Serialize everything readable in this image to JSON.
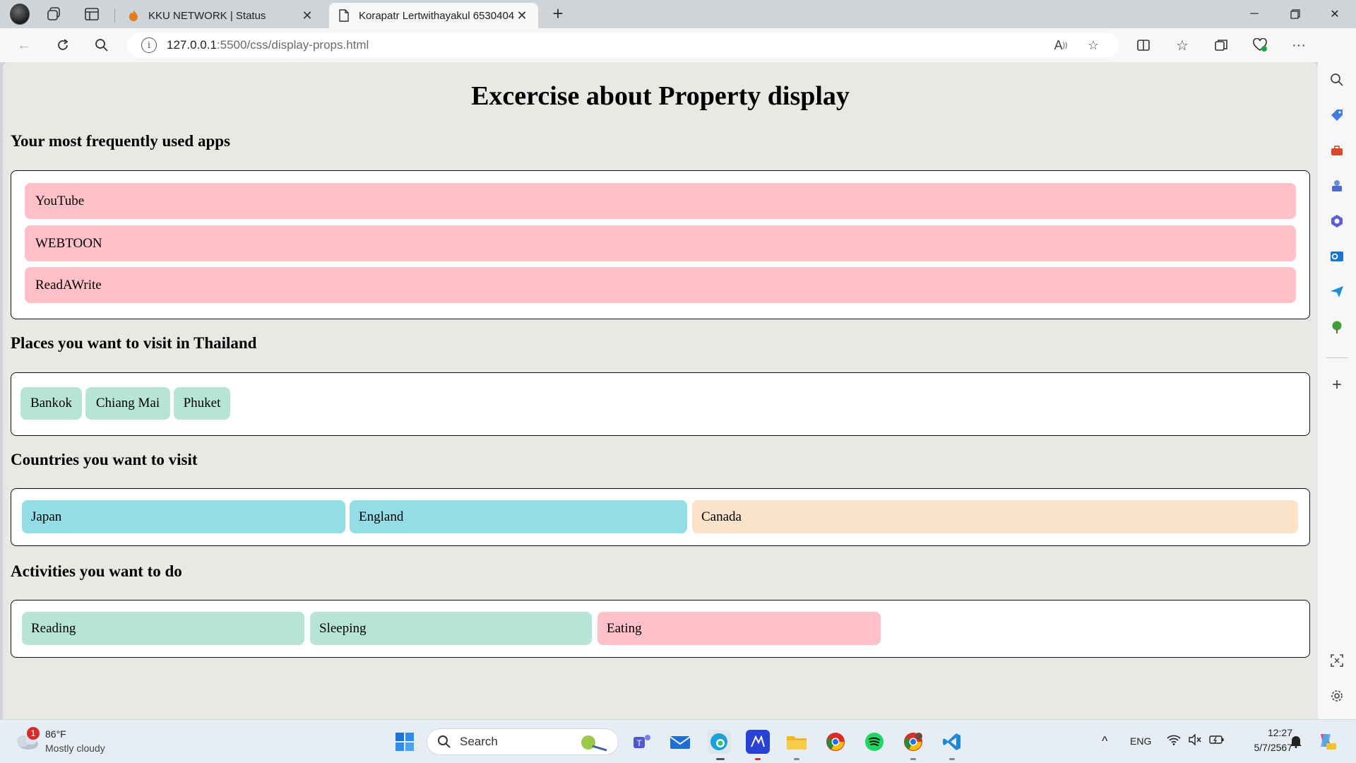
{
  "browser": {
    "tabs": [
      {
        "title": "KKU NETWORK | Status",
        "active": false
      },
      {
        "title": "Korapatr Lertwithayakul 6530404",
        "active": true
      }
    ],
    "url_host": "127.0.0.1",
    "url_path": ":5500/css/display-props.html"
  },
  "page": {
    "title": "Excercise about Property display",
    "sections": {
      "apps": {
        "heading": "Your most frequently used apps",
        "items": [
          "YouTube",
          "WEBTOON",
          "ReadAWrite"
        ]
      },
      "places": {
        "heading": "Places you want to visit in Thailand",
        "items": [
          "Bankok",
          "Chiang Mai",
          "Phuket"
        ]
      },
      "countries": {
        "heading": "Countries you want to visit",
        "items": [
          "Japan",
          "England",
          "Canada"
        ]
      },
      "activities": {
        "heading": "Activities you want to do",
        "items": [
          "Reading",
          "Sleeping",
          "Eating"
        ]
      }
    }
  },
  "colors": {
    "pink": "#ffc0c7",
    "mint": "#b6e5d8",
    "blue": "#93dde7",
    "peach": "#fae3c8"
  },
  "taskbar": {
    "weather_badge": "1",
    "weather_temp": "86°F",
    "weather_desc": "Mostly cloudy",
    "search_placeholder": "Search",
    "language": "ENG",
    "time": "12:27",
    "date": "5/7/2567"
  }
}
